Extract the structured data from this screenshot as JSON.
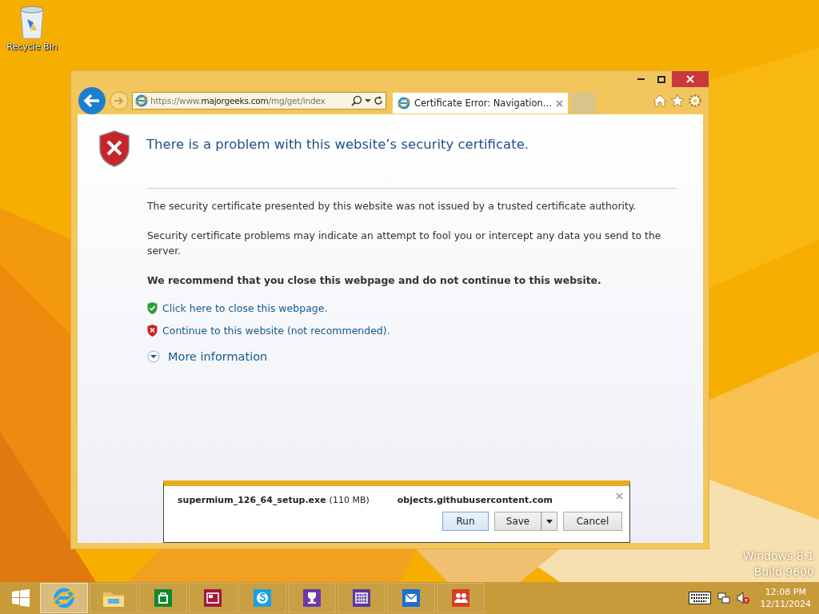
{
  "desktop_icons": [
    {
      "label": "Recycle Bin"
    }
  ],
  "browser": {
    "address": {
      "prefix": "https://www.",
      "domain": "majorgeeks.com",
      "path": "/mg/get/index"
    },
    "tabs": [
      {
        "title": "Certificate Error: Navigation…",
        "selected": true
      }
    ],
    "page": {
      "heading": "There is a problem with this website’s security certificate.",
      "paragraphs": [
        "The security certificate presented by this website was not issued by a trusted certificate authority.",
        "Security certificate problems may indicate an attempt to fool you or intercept any data you send to the server."
      ],
      "recommendation": "We recommend that you close this webpage and do not continue to this website.",
      "links": [
        {
          "kind": "safe",
          "text": "Click here to close this webpage."
        },
        {
          "kind": "unsafe",
          "text": "Continue to this website (not recommended)."
        }
      ],
      "more_info": {
        "text": "More information"
      }
    },
    "download_bar": {
      "filename": "supermium_126_64_setup.exe",
      "size": "(110 MB)",
      "source": "objects.githubusercontent.com",
      "buttons": [
        {
          "label": "Run",
          "kind": "plain",
          "hover": true
        },
        {
          "label": "Save",
          "kind": "split",
          "hover": false
        },
        {
          "label": "Cancel",
          "kind": "plain",
          "hover": false
        }
      ]
    }
  },
  "watermark": [
    "Windows 8.1",
    "Build 9600"
  ],
  "taskbar": {
    "apps": [
      {
        "kind": "ie",
        "selected": true
      },
      {
        "kind": "explorer",
        "selected": false
      },
      {
        "kind": "store",
        "selected": false
      },
      {
        "kind": "news",
        "selected": false
      },
      {
        "kind": "skype",
        "selected": false
      },
      {
        "kind": "trophy",
        "selected": false
      },
      {
        "kind": "calendar",
        "selected": false
      },
      {
        "kind": "mail",
        "selected": false
      },
      {
        "kind": "people",
        "selected": false
      }
    ],
    "clock": {
      "time": "12:08 PM",
      "date": "12/11/2024"
    }
  }
}
